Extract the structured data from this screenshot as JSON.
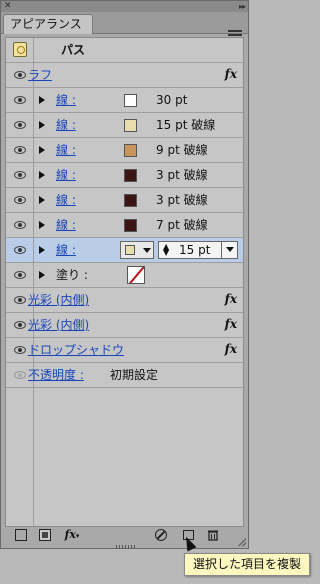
{
  "panel": {
    "tab_title": "アピアランス",
    "tab_arrows": "▸▸"
  },
  "object_row": {
    "label": "パス",
    "icon": "path-thumbnail-icon"
  },
  "rows": [
    {
      "label": "ラフ",
      "fx": "fx"
    },
    {
      "label": "線 :",
      "value": "30 pt",
      "swatch": "#ffffff"
    },
    {
      "label": "線 :",
      "value": "15 pt 破線",
      "swatch": "#e9dcad"
    },
    {
      "label": "線 :",
      "value": "9 pt 破線",
      "swatch": "#c8955a"
    },
    {
      "label": "線 :",
      "value": "3 pt 破線",
      "swatch": "#3b1414"
    },
    {
      "label": "線 :",
      "value": "3 pt 破線",
      "swatch": "#3b1414"
    },
    {
      "label": "線 :",
      "value": "7 pt 破線",
      "swatch": "#3b1414"
    },
    {
      "label": "線 :",
      "value": "15 pt",
      "swatch": "#e9dcad",
      "selected": true
    },
    {
      "label": "塗り :",
      "swatch": "none"
    },
    {
      "label": "光彩 (内側)",
      "fx": "fx"
    },
    {
      "label": "光彩 (内側)",
      "fx": "fx"
    },
    {
      "label": "ドロップシャドウ",
      "fx": "fx"
    },
    {
      "label": "不透明度 :",
      "value": "初期設定"
    }
  ],
  "bottom_bar": {
    "fx_label": "fx",
    "fx_arrow": "▾",
    "clear_icon": "⃠",
    "trash_icon": "🗑"
  },
  "tooltip": "選択した項目を複製",
  "colors": {
    "link": "#1a45b8",
    "selected_row": "#b9cde8"
  }
}
